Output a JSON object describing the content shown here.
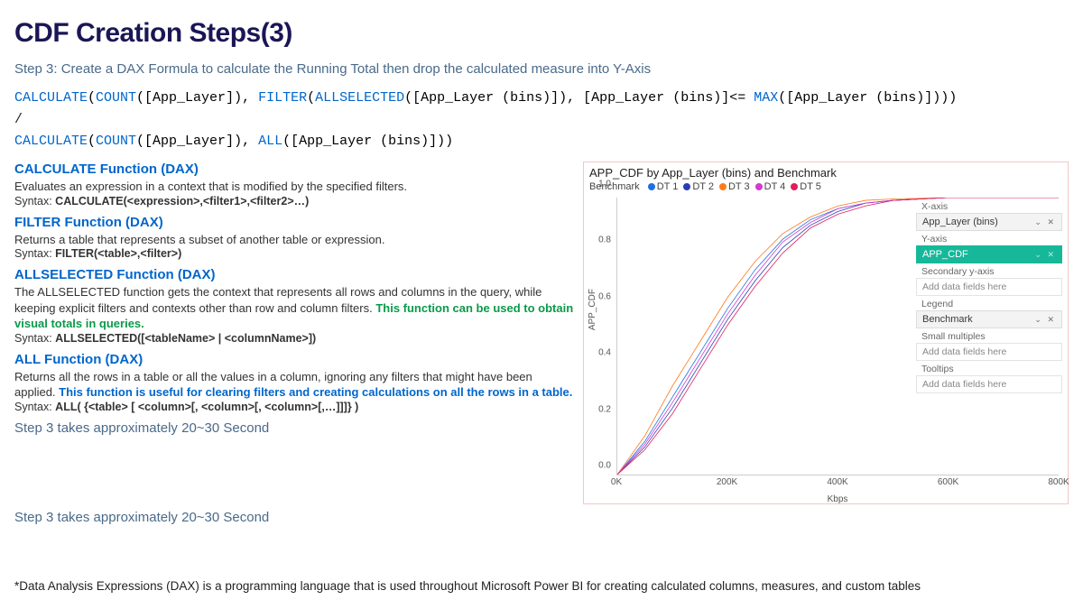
{
  "title": "CDF Creation Steps(3)",
  "step_desc": "Step 3: Create a DAX Formula to calculate the Running Total then drop the calculated measure into Y-Axis",
  "formula": {
    "tokens": [
      {
        "t": "CALCULATE",
        "c": "blue"
      },
      {
        "t": "(",
        "c": "black"
      },
      {
        "t": "COUNT",
        "c": "blue"
      },
      {
        "t": "([App_Layer]), ",
        "c": "black"
      },
      {
        "t": "FILTER",
        "c": "blue"
      },
      {
        "t": "(",
        "c": "black"
      },
      {
        "t": "ALLSELECTED",
        "c": "blue"
      },
      {
        "t": "([App_Layer (bins)]), [App_Layer (bins)]<= ",
        "c": "black"
      },
      {
        "t": "MAX",
        "c": "blue"
      },
      {
        "t": "([App_Layer (bins)])))",
        "c": "black"
      }
    ],
    "line2": "/",
    "tokens3": [
      {
        "t": "CALCULATE",
        "c": "blue"
      },
      {
        "t": "(",
        "c": "black"
      },
      {
        "t": "COUNT",
        "c": "blue"
      },
      {
        "t": "([App_Layer]), ",
        "c": "black"
      },
      {
        "t": "ALL",
        "c": "blue"
      },
      {
        "t": "([App_Layer (bins)]))",
        "c": "black"
      }
    ]
  },
  "functions": [
    {
      "title": "CALCULATE Function (DAX)",
      "desc_pre": "Evaluates an expression in a context that is modified by the specified filters. ",
      "desc_emph": "",
      "desc_post": "",
      "syntax_label": "Syntax:",
      "syntax": "CALCULATE(<expression>,<filter1>,<filter2>…)"
    },
    {
      "title": "FILTER Function (DAX)",
      "desc_pre": "Returns a table that represents a subset of another table or expression.",
      "desc_emph": "",
      "desc_post": "",
      "syntax_label": "Syntax:",
      "syntax": "FILTER(<table>,<filter>)"
    },
    {
      "title": "ALLSELECTED Function (DAX)",
      "desc_pre": "The ALLSELECTED function gets the context that represents all rows and columns in the query, while keeping explicit filters and contexts other than row and column filters. ",
      "desc_emph": "This function can be used to obtain visual totals in queries.",
      "emph_class": "green",
      "desc_post": "",
      "syntax_label": "Syntax:",
      "syntax": "ALLSELECTED([<tableName> | <columnName>])"
    },
    {
      "title": "ALL Function (DAX)",
      "desc_pre": "Returns all the rows in a table or all the values in a column, ignoring any filters that might have been applied. ",
      "desc_emph": "This function is useful for clearing filters and creating calculations on all the rows in a table.",
      "emph_class": "blue",
      "desc_post": "",
      "syntax_label": "Syntax:",
      "syntax": "ALL( {<table> [ <column>[, <column>[, <column>[,…]]]} )"
    }
  ],
  "step_time": "Step 3 takes approximately 20~30 Second",
  "footnote": "*Data Analysis Expressions (DAX) is a programming language that is used throughout Microsoft Power BI for creating calculated columns, measures, and custom tables",
  "chart_title": "APP_CDF by App_Layer (bins) and Benchmark",
  "legend_label": "Benchmark",
  "chart_data": {
    "type": "line",
    "title": "APP_CDF by App_Layer (bins) and Benchmark",
    "xlabel": "Kbps",
    "ylabel": "APP_CDF",
    "xlim": [
      0,
      800
    ],
    "ylim": [
      0,
      1.0
    ],
    "x_ticks": [
      "0K",
      "200K",
      "400K",
      "600K",
      "800K"
    ],
    "y_ticks": [
      "0.0",
      "0.2",
      "0.4",
      "0.6",
      "0.8",
      "1.0"
    ],
    "x": [
      0,
      50,
      100,
      150,
      200,
      250,
      300,
      350,
      400,
      450,
      500,
      600,
      700,
      800
    ],
    "series": [
      {
        "name": "DT 1",
        "color": "#1f6fe0",
        "values": [
          0.0,
          0.12,
          0.28,
          0.44,
          0.6,
          0.74,
          0.85,
          0.92,
          0.96,
          0.98,
          0.99,
          1.0,
          1.0,
          1.0
        ]
      },
      {
        "name": "DT 2",
        "color": "#2a3db8",
        "values": [
          0.0,
          0.1,
          0.24,
          0.4,
          0.56,
          0.7,
          0.82,
          0.9,
          0.95,
          0.98,
          0.99,
          1.0,
          1.0,
          1.0
        ]
      },
      {
        "name": "DT 3",
        "color": "#ff7a1a",
        "values": [
          0.0,
          0.14,
          0.32,
          0.48,
          0.64,
          0.77,
          0.87,
          0.93,
          0.97,
          0.99,
          0.995,
          1.0,
          1.0,
          1.0
        ]
      },
      {
        "name": "DT 4",
        "color": "#d23ad2",
        "values": [
          0.0,
          0.11,
          0.26,
          0.42,
          0.58,
          0.72,
          0.84,
          0.91,
          0.96,
          0.98,
          0.99,
          1.0,
          1.0,
          1.0
        ]
      },
      {
        "name": "DT 5",
        "color": "#e01f5a",
        "values": [
          0.0,
          0.09,
          0.22,
          0.38,
          0.54,
          0.68,
          0.8,
          0.89,
          0.94,
          0.97,
          0.99,
          1.0,
          1.0,
          1.0
        ]
      }
    ]
  },
  "config_panel": {
    "sections": [
      {
        "label": "X-axis",
        "field": "App_Layer (bins)",
        "active": false,
        "has_icons": true
      },
      {
        "label": "Y-axis",
        "field": "APP_CDF",
        "active": true,
        "has_icons": true
      },
      {
        "label": "Secondary y-axis",
        "placeholder": "Add data fields here"
      },
      {
        "label": "Legend",
        "field": "Benchmark",
        "active": false,
        "has_icons": true
      },
      {
        "label": "Small multiples",
        "placeholder": "Add data fields here"
      },
      {
        "label": "Tooltips",
        "placeholder": "Add data fields here"
      }
    ],
    "icons_text": "⌄ ✕"
  }
}
